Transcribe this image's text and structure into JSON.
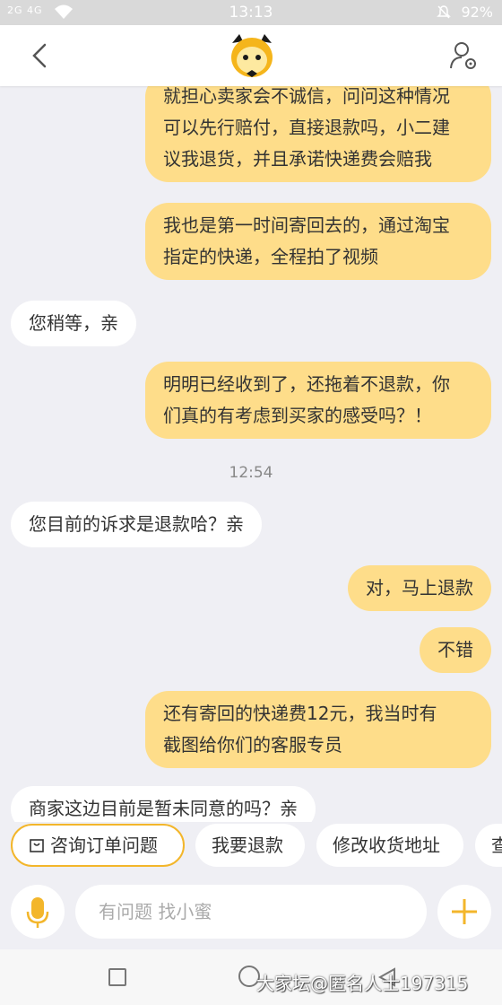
{
  "status_bar": {
    "signal": "2G 4G",
    "time": "13:13",
    "battery": "92%"
  },
  "chat": {
    "messages": [
      {
        "side": "out",
        "lines": [
          "就担心卖家会不诚信，问问这种情况",
          "可以先行赔付，直接退款吗，小二建",
          "议我退货，并且承诺快递费会赔我"
        ]
      },
      {
        "side": "out",
        "lines": [
          "我也是第一时间寄回去的，通过淘宝",
          "指定的快递，全程拍了视频"
        ]
      },
      {
        "side": "in",
        "lines": [
          "您稍等，亲"
        ]
      },
      {
        "side": "out",
        "lines": [
          "明明已经收到了，还拖着不退款，你",
          "们真的有考虑到买家的感受吗？！"
        ]
      },
      {
        "side": "in",
        "lines": [
          "您目前的诉求是退款哈？亲"
        ]
      },
      {
        "side": "out",
        "lines": [
          "对，马上退款"
        ]
      },
      {
        "side": "out",
        "lines": [
          "不错"
        ]
      },
      {
        "side": "out",
        "lines": [
          "还有寄回的快递费12元，我当时有",
          "截图给你们的客服专员"
        ]
      },
      {
        "side": "in",
        "lines": [
          "商家这边目前是暂未同意的吗？亲"
        ]
      }
    ],
    "timestamp": "12:54"
  },
  "quick_replies": [
    "咨询订单问题",
    "我要退款",
    "修改收货地址",
    "查"
  ],
  "input": {
    "placeholder": "有问题 找小蜜"
  },
  "watermark": "大家坛@匿名人士197315",
  "colors": {
    "accent": "#f3b62b",
    "outgoing_bubble": "#fedd8a"
  }
}
